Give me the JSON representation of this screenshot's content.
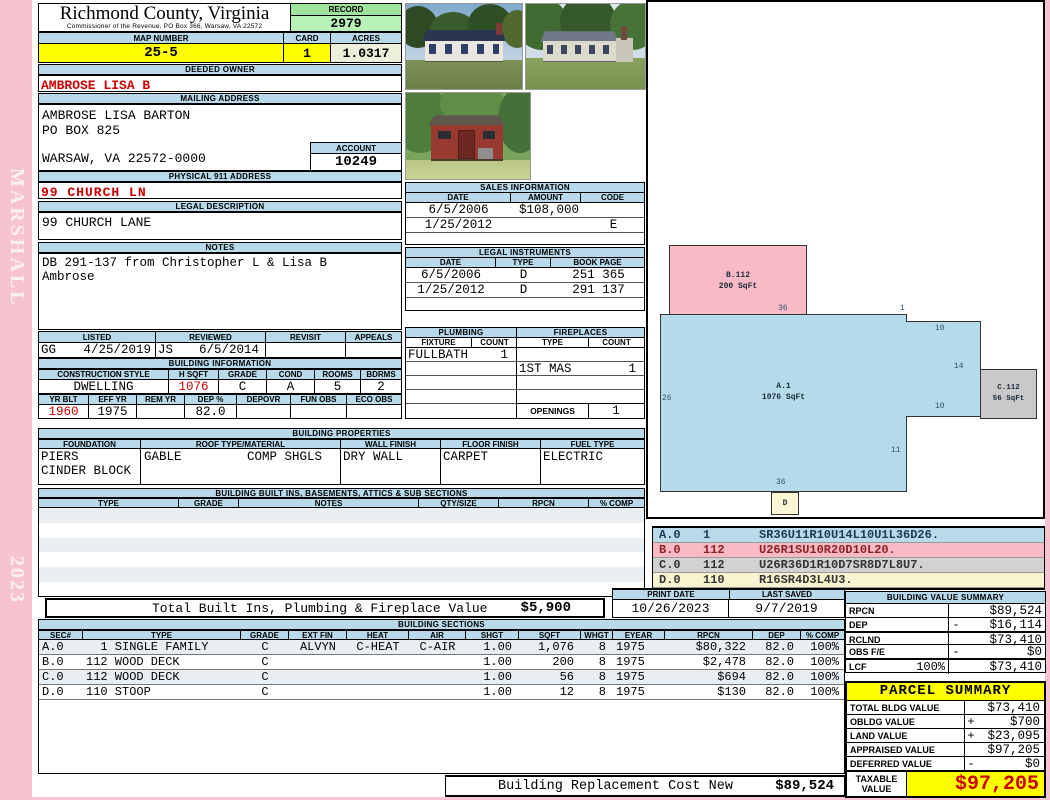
{
  "page": {
    "county_tag": "MARSHALL",
    "year": "2023"
  },
  "header": {
    "title": "Richmond County, Virginia",
    "subtitle": "Commissioner of the Revenue, PO Box 366, Warsaw, VA 22572",
    "record_label": "RECORD",
    "record_value": "2979",
    "map_label": "MAP NUMBER",
    "map_value": "25-5",
    "card_label": "CARD",
    "card_value": "1",
    "acres_label": "ACRES",
    "acres_value": "1.0317"
  },
  "owner": {
    "label": "DEEDED OWNER",
    "value": "AMBROSE LISA B"
  },
  "mailing": {
    "label": "MAILING ADDRESS",
    "line1": "AMBROSE LISA BARTON",
    "line2": "PO BOX 825",
    "line3": "WARSAW, VA 22572-0000",
    "account_label": "ACCOUNT",
    "account_value": "10249"
  },
  "physical": {
    "label": "PHYSICAL 911 ADDRESS",
    "value": "99 CHURCH LN"
  },
  "legal": {
    "label": "LEGAL DESCRIPTION",
    "value": "99 CHURCH LANE"
  },
  "notes": {
    "label": "NOTES",
    "line1": "DB 291-137 from Christopher L & Lisa B",
    "line2": "Ambrose"
  },
  "review": {
    "headers": [
      "LISTED",
      "REVIEWED",
      "REVISIT",
      "APPEALS"
    ],
    "listed_by": "GG",
    "listed_date": "4/25/2019",
    "reviewed_by": "JS",
    "reviewed_date": "6/5/2014"
  },
  "building_info": {
    "label": "BUILDING INFORMATION",
    "row1_headers": [
      "CONSTRUCTION STYLE",
      "H SQFT",
      "GRADE",
      "COND",
      "ROOMS",
      "BDRMS"
    ],
    "row1_values": [
      "DWELLING",
      "1076",
      "C",
      "A",
      "5",
      "2"
    ],
    "row2_headers": [
      "YR BLT",
      "EFF YR",
      "REM YR",
      "DEP %",
      "DEPOVR",
      "FUN OBS",
      "ECO OBS"
    ],
    "row2_values": [
      "1960",
      "1975",
      "",
      "82.0",
      "",
      "",
      ""
    ]
  },
  "building_props": {
    "label": "BUILDING PROPERTIES",
    "headers": [
      "FOUNDATION",
      "ROOF TYPE/MATERIAL",
      "WALL FINISH",
      "FLOOR FINISH",
      "FUEL TYPE"
    ],
    "foundation1": "PIERS",
    "foundation2": "CINDER BLOCK",
    "roof_type": "GABLE",
    "roof_material": "COMP SHGLS",
    "wall_finish": "DRY WALL",
    "floor_finish": "CARPET",
    "fuel_type": "ELECTRIC"
  },
  "built_ins": {
    "label": "BUILDING BUILT INS, BASEMENTS, ATTICS & SUB SECTIONS",
    "headers": [
      "TYPE",
      "GRADE",
      "NOTES",
      "QTY/SIZE",
      "RPCN",
      "% COMP"
    ],
    "total_label": "Total Built Ins, Plumbing & Fireplace Value",
    "total_value": "$5,900"
  },
  "sales": {
    "label": "SALES INFORMATION",
    "headers": [
      "DATE",
      "AMOUNT",
      "CODE"
    ],
    "rows": [
      {
        "date": "6/5/2006",
        "amount": "$108,000",
        "code": ""
      },
      {
        "date": "1/25/2012",
        "amount": "",
        "code": "E"
      }
    ]
  },
  "instruments": {
    "label": "LEGAL INSTRUMENTS",
    "headers": [
      "DATE",
      "TYPE",
      "BOOK PAGE"
    ],
    "rows": [
      {
        "date": "6/5/2006",
        "type": "D",
        "book": "251 365"
      },
      {
        "date": "1/25/2012",
        "type": "D",
        "book": "291 137"
      }
    ]
  },
  "plumbing": {
    "label": "PLUMBING",
    "headers": [
      "FIXTURE",
      "COUNT"
    ],
    "fixture": "FULLBATH",
    "count": "1"
  },
  "fireplaces": {
    "label": "FIREPLACES",
    "headers": [
      "TYPE",
      "COUNT"
    ],
    "type": "1ST MAS",
    "count": "1",
    "openings_label": "OPENINGS",
    "openings_count": "1"
  },
  "print_info": {
    "print_label": "PRINT DATE",
    "print_value": "10/26/2023",
    "saved_label": "LAST SAVED",
    "saved_value": "9/7/2019"
  },
  "sections": {
    "label": "BUILDING SECTIONS",
    "headers": [
      "SEC#",
      "TYPE",
      "GRADE",
      "EXT FIN",
      "HEAT",
      "AIR",
      "SHGT",
      "SQFT",
      "WHGT",
      "EYEAR",
      "RPCN",
      "DEP",
      "% COMP"
    ],
    "rows": [
      [
        "A.0",
        "  1 SINGLE FAMILY",
        "C",
        "ALVYN",
        "C-HEAT",
        "C-AIR",
        "1.00",
        "1,076",
        "8",
        "1975",
        "$80,322",
        "82.0",
        "100%"
      ],
      [
        "B.0",
        "112 WOOD DECK",
        "C",
        "",
        "",
        "",
        "1.00",
        "200",
        "8",
        "1975",
        "$2,478",
        "82.0",
        "100%"
      ],
      [
        "C.0",
        "112 WOOD DECK",
        "C",
        "",
        "",
        "",
        "1.00",
        "56",
        "8",
        "1975",
        "$694",
        "82.0",
        "100%"
      ],
      [
        "D.0",
        "110 STOOP",
        "C",
        "",
        "",
        "",
        "1.00",
        "12",
        "8",
        "1975",
        "$130",
        "82.0",
        "100%"
      ]
    ]
  },
  "sketch": {
    "areas": {
      "a": {
        "id": "A.1",
        "sqft": "1076 SqFt"
      },
      "b": {
        "id": "B.112",
        "sqft": "200 SqFt"
      },
      "c": {
        "id": "C.112",
        "sqft": "56 SqFt"
      },
      "d": {
        "id": "D"
      }
    },
    "dims": {
      "top": "36",
      "step": "1",
      "ext_top": "10",
      "ext_right": "14",
      "left": "26",
      "ext_bottom": "10",
      "right_lower": "11",
      "bottom": "36"
    },
    "vectors": [
      {
        "id": "A.0",
        "num": "1",
        "vector": "SR36U11R10U14L10U1L36D26.",
        "bg": "#bad9e9",
        "fg": "#1a3a55"
      },
      {
        "id": "B.0",
        "num": "112",
        "vector": "U26R1SU10R20D10L20.",
        "bg": "#f9bac6",
        "fg": "#8c1f1f"
      },
      {
        "id": "C.0",
        "num": "112",
        "vector": "U26R36D1R10D7SR8D7L8U7.",
        "bg": "#d2d2d2",
        "fg": "#333333"
      },
      {
        "id": "D.0",
        "num": "110",
        "vector": "R16SR4D3L4U3.",
        "bg": "#f8f4d0",
        "fg": "#333333"
      }
    ]
  },
  "value_summary": {
    "label": "BUILDING VALUE SUMMARY",
    "rows": [
      {
        "label": "RPCN",
        "sub": "",
        "op": "",
        "value": "$89,524"
      },
      {
        "label": "DEP",
        "sub": "",
        "op": "-",
        "value": "$16,114"
      },
      {
        "label": "RCLND",
        "sub": "",
        "op": "",
        "value": "$73,410"
      },
      {
        "label": "OBS F/E",
        "sub": "",
        "op": "-",
        "value": "$0"
      },
      {
        "label": "LCF",
        "sub": "100%",
        "op": "",
        "value": "$73,410"
      }
    ]
  },
  "parcel": {
    "label": "PARCEL SUMMARY",
    "rows": [
      {
        "label": "TOTAL BLDG VALUE",
        "op": "",
        "value": "$73,410"
      },
      {
        "label": "OBLDG VALUE",
        "op": "+",
        "value": "$700"
      },
      {
        "label": "LAND VALUE",
        "op": "+",
        "value": "$23,095"
      },
      {
        "label": "APPRAISED VALUE",
        "op": "",
        "value": "$97,205"
      },
      {
        "label": "DEFERRED VALUE",
        "op": "-",
        "value": "$0"
      }
    ],
    "taxable_label": "TAXABLE VALUE",
    "taxable_value": "$97,205"
  },
  "replacement": {
    "label": "Building Replacement Cost New",
    "value": "$89,524"
  },
  "colors": {
    "header_blue": "#b7d9e9",
    "record_green": "#a9eba9",
    "highlight_yellow": "#ffff00",
    "acres_cream": "#eeeedd",
    "alert_red": "#cc0000",
    "page_pink": "#f7c3cf",
    "sketch_blue": "#b4dbea",
    "sketch_pink": "#f9bac6",
    "sketch_gray": "#c9c9c9",
    "sketch_cream": "#fbf7d5"
  }
}
